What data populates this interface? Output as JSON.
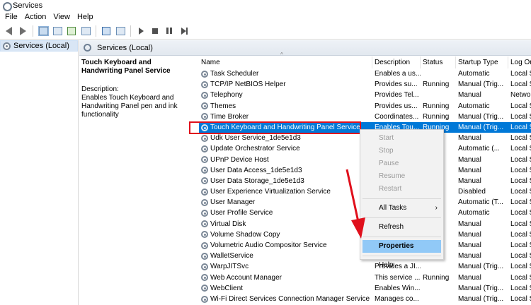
{
  "window": {
    "title": "Services"
  },
  "menu": [
    "File",
    "Action",
    "View",
    "Help"
  ],
  "toolbar": {
    "icons": [
      "back-arrow-icon",
      "forward-arrow-icon",
      "console-tree-icon",
      "properties-icon",
      "refresh-icon",
      "export-icon",
      "help-icon",
      "show-hide-icon",
      "start-service-icon",
      "stop-service-icon",
      "pause-service-icon",
      "restart-service-icon"
    ]
  },
  "tree": {
    "root_label": "Services (Local)"
  },
  "pane": {
    "title": "Services (Local)"
  },
  "details": {
    "service_title": "Touch Keyboard and Handwriting Panel Service",
    "description_label": "Description:",
    "description_text": "Enables Touch Keyboard and Handwriting Panel pen and ink functionality"
  },
  "table": {
    "columns": [
      "Name",
      "Description",
      "Status",
      "Startup Type",
      "Log On As"
    ],
    "column_labels": [
      "Name",
      "Description",
      "Status",
      "Startup Type",
      "Log On"
    ],
    "rows": [
      {
        "name": "Task Scheduler",
        "description": "Enables a us...",
        "status": "",
        "startup": "Automatic",
        "logon": "Local Sy"
      },
      {
        "name": "TCP/IP NetBIOS Helper",
        "description": "Provides su...",
        "status": "Running",
        "startup": "Manual (Trig...",
        "logon": "Local Se"
      },
      {
        "name": "Telephony",
        "description": "Provides Tel...",
        "status": "",
        "startup": "Manual",
        "logon": "Networ"
      },
      {
        "name": "Themes",
        "description": "Provides us...",
        "status": "Running",
        "startup": "Automatic",
        "logon": "Local Sy"
      },
      {
        "name": "Time Broker",
        "description": "Coordinates...",
        "status": "Running",
        "startup": "Manual (Trig...",
        "logon": "Local Se"
      },
      {
        "name": "Touch Keyboard and Handwriting Panel Service",
        "description": "Enables Tou...",
        "status": "Running",
        "startup": "Manual (Trig...",
        "logon": "Local Sy",
        "selected": true
      },
      {
        "name": "Udk User Service_1de5e1d3",
        "description": "",
        "status": "",
        "startup": "Manual",
        "logon": "Local Sy"
      },
      {
        "name": "Update Orchestrator Service",
        "description": "",
        "status": "",
        "startup": "Automatic (...",
        "logon": "Local Sy"
      },
      {
        "name": "UPnP Device Host",
        "description": "",
        "status": "",
        "startup": "Manual",
        "logon": "Local Se"
      },
      {
        "name": "User Data Access_1de5e1d3",
        "description": "",
        "status": "",
        "startup": "Manual",
        "logon": "Local Sy"
      },
      {
        "name": "User Data Storage_1de5e1d3",
        "description": "",
        "status": "",
        "startup": "Manual",
        "logon": "Local Sy"
      },
      {
        "name": "User Experience Virtualization Service",
        "description": "",
        "status": "",
        "startup": "Disabled",
        "logon": "Local Sy"
      },
      {
        "name": "User Manager",
        "description": "",
        "status": "",
        "startup": "Automatic (T...",
        "logon": "Local Sy"
      },
      {
        "name": "User Profile Service",
        "description": "",
        "status": "",
        "startup": "Automatic",
        "logon": "Local Sy"
      },
      {
        "name": "Virtual Disk",
        "description": "",
        "status": "",
        "startup": "Manual",
        "logon": "Local Sy"
      },
      {
        "name": "Volume Shadow Copy",
        "description": "",
        "status": "",
        "startup": "Manual",
        "logon": "Local Sy"
      },
      {
        "name": "Volumetric Audio Compositor Service",
        "description": "",
        "status": "",
        "startup": "Manual",
        "logon": "Local Sy"
      },
      {
        "name": "WalletService",
        "description": "",
        "status": "",
        "startup": "Manual",
        "logon": "Local Sy"
      },
      {
        "name": "WarpJITSvc",
        "description": "Provides a JI...",
        "status": "",
        "startup": "Manual (Trig...",
        "logon": "Local Se"
      },
      {
        "name": "Web Account Manager",
        "description": "This service ...",
        "status": "Running",
        "startup": "Manual",
        "logon": "Local Sy"
      },
      {
        "name": "WebClient",
        "description": "Enables Win...",
        "status": "",
        "startup": "Manual (Trig...",
        "logon": "Local Se"
      },
      {
        "name": "Wi-Fi Direct Services Connection Manager Service",
        "description": "Manages co...",
        "status": "",
        "startup": "Manual (Trig...",
        "logon": "Local Se"
      }
    ]
  },
  "context_menu": {
    "items": [
      {
        "label": "Start",
        "disabled": true
      },
      {
        "label": "Stop",
        "disabled": true
      },
      {
        "label": "Pause",
        "disabled": true
      },
      {
        "label": "Resume",
        "disabled": true
      },
      {
        "label": "Restart",
        "disabled": true
      },
      {
        "separator": true
      },
      {
        "label": "All Tasks",
        "submenu": true
      },
      {
        "separator": true
      },
      {
        "label": "Refresh"
      },
      {
        "separator": true
      },
      {
        "label": "Properties",
        "highlighted": true
      },
      {
        "separator": true
      },
      {
        "label": "Help"
      }
    ],
    "submenu_glyph": "›"
  },
  "colors": {
    "selection": "#0078d7",
    "annotation_red": "#e0101c",
    "menu_hover": "#91c9f7"
  }
}
